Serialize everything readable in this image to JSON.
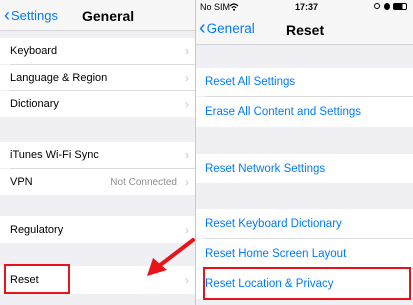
{
  "left": {
    "nav": {
      "back": "Settings",
      "title": "General"
    },
    "groups": [
      [
        {
          "label": "Keyboard"
        },
        {
          "label": "Language & Region"
        },
        {
          "label": "Dictionary"
        }
      ],
      [
        {
          "label": "iTunes Wi-Fi Sync"
        },
        {
          "label": "VPN",
          "value": "Not Connected"
        }
      ],
      [
        {
          "label": "Regulatory"
        }
      ],
      [
        {
          "label": "Reset"
        }
      ]
    ]
  },
  "right": {
    "status": {
      "carrier": "No SIM",
      "time": "17:37"
    },
    "nav": {
      "back": "General",
      "title": "Reset"
    },
    "groups": [
      [
        {
          "label": "Reset All Settings"
        },
        {
          "label": "Erase All Content and Settings"
        }
      ],
      [
        {
          "label": "Reset Network Settings"
        }
      ],
      [
        {
          "label": "Reset Keyboard Dictionary"
        },
        {
          "label": "Reset Home Screen Layout"
        },
        {
          "label": "Reset Location & Privacy"
        }
      ]
    ]
  },
  "colors": {
    "accent": "#007aff",
    "highlight": "#e8141a",
    "group_bg": "#efeff4"
  }
}
